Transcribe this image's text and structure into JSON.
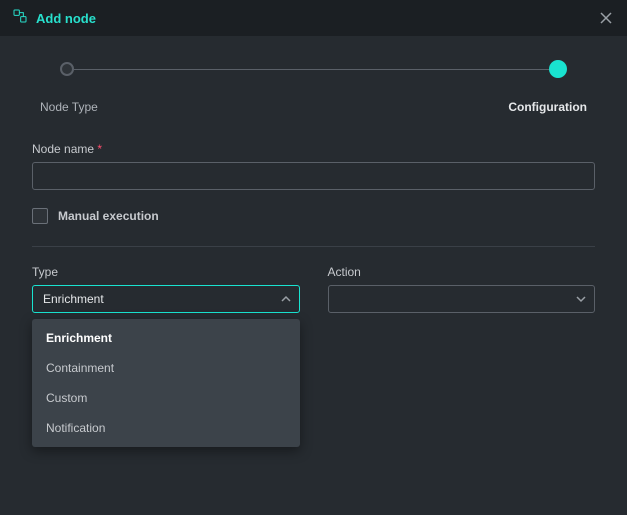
{
  "header": {
    "title": "Add node"
  },
  "stepper": {
    "step1": "Node Type",
    "step2": "Configuration",
    "activeIndex": 1
  },
  "form": {
    "nodeNameLabel": "Node name",
    "nodeNameValue": "",
    "manualExecLabel": "Manual execution",
    "typeLabel": "Type",
    "typeValue": "Enrichment",
    "typeOptions": {
      "o0": "Enrichment",
      "o1": "Containment",
      "o2": "Custom",
      "o3": "Notification"
    },
    "actionLabel": "Action",
    "actionValue": ""
  }
}
